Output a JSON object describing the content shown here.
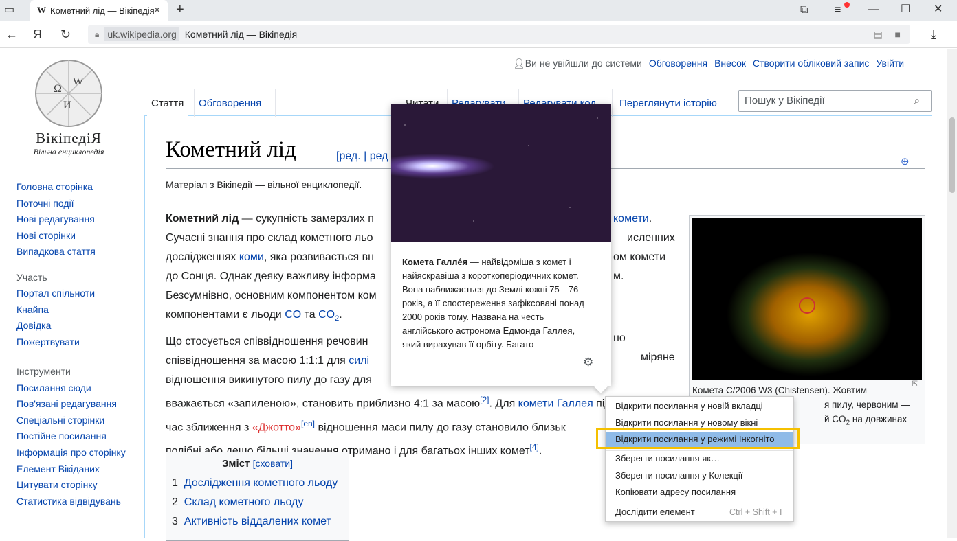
{
  "browser": {
    "tab_title": "Кометний лід — Вікіпедія",
    "favicon": "W",
    "url_domain": "uk.wikipedia.org",
    "url_title": "Кометний лід — Вікіпедія",
    "yandex_logo": "Я"
  },
  "top_links": {
    "not_logged": "Ви не увійшли до системи",
    "talk": "Обговорення",
    "contrib": "Внесок",
    "create": "Створити обліковий запис",
    "login": "Увійти"
  },
  "logo": {
    "name": "ВікіпедіЯ",
    "tagline": "Вільна енциклопедія"
  },
  "sidebar": {
    "nav": [
      "Головна сторінка",
      "Поточні події",
      "Нові редагування",
      "Нові сторінки",
      "Випадкова стаття"
    ],
    "participation_title": "Участь",
    "participation": [
      "Портал спільноти",
      "Кнайпа",
      "Довідка",
      "Пожертвувати"
    ],
    "tools_title": "Інструменти",
    "tools": [
      "Посилання сюди",
      "Пов'язані редагування",
      "Спеціальні сторінки",
      "Постійне посилання",
      "Інформація про сторінку",
      "Елемент Вікіданих",
      "Цитувати сторінку",
      "Статистика відвідувань"
    ]
  },
  "tabs": {
    "article": "Стаття",
    "discussion": "Обговорення",
    "read": "Читати",
    "edit": "Редагувати",
    "edit_code": "Редагувати код",
    "history": "Переглянути історію"
  },
  "search": {
    "placeholder": "Пошук у Вікіпедії"
  },
  "article": {
    "title": "Кометний лід",
    "edit_links": "[ред. | ред",
    "from": "Матеріал з Вікіпедії — вільної енциклопедії.",
    "p1_bold": "Кометний лід",
    "p1_a": " — сукупність замерзлих п",
    "p1_link_end": "комети",
    "l2_a": "Сучасні знання про склад кометного льо",
    "l2_b": "исленних",
    "l3_a": "дослідженнях ",
    "l3_link": "коми",
    "l3_b": ", яка розвивається вн",
    "l3_c": "ом комети",
    "l4_a": "до Сонця. Однак деяку важливу інформа",
    "l4_b": "м.",
    "l5_a": "Безсумнівно, основним компонентом ком",
    "l6_a": "компонентами є льоди ",
    "l6_co": "CO",
    "l6_and": " та ",
    "l6_co2": "CO",
    "l6_sub": "2",
    "l6_end": ".",
    "p2_l1_a": "Що стосується співвідношення речовин",
    "p2_l1_b": "но",
    "p2_l2_a": "співвідношення за масою 1:1:1 для ",
    "p2_l2_link": "силі",
    "p2_l2_b": "міряне",
    "p2_l3_a": "відношення викинутого пилу до газу для",
    "p2_l4_a": "вважається «запиленою», становить приблизно 4:1 за масою",
    "p2_l4_ref": "[2]",
    "p2_l4_b": ". Для ",
    "p2_l4_link": "комети Галлея",
    "p2_l4_c": " під",
    "p2_l5_a": "час зближення з ",
    "p2_l5_red": "«Джотто»",
    "p2_l5_ref": "[en]",
    "p2_l5_b": " відношення маси пилу до газу становило близьк",
    "p2_l6_a": "подібні або дещо більші значення отримано і для багатьох інших комет",
    "p2_l6_ref": "[4]",
    "p2_l6_b": "."
  },
  "toc": {
    "title": "Зміст",
    "hide": "[сховати]",
    "items": [
      {
        "n": "1",
        "t": "Дослідження кометного льоду"
      },
      {
        "n": "2",
        "t": "Склад кометного льоду"
      },
      {
        "n": "3",
        "t": "Активність віддалених комет"
      }
    ]
  },
  "figure": {
    "caption_l1": "Комета C/2006 W3 (Chistensen). Жовтим",
    "caption_l2": "я пилу, червоним —",
    "caption_l3": "й CO",
    "caption_sub": "2",
    "caption_l3b": " на довжинах"
  },
  "popup": {
    "bold": "Комета Галле́я",
    "text_lines": [
      " — найвідоміша з комет і",
      "найяскравіша з короткоперіодичних комет.",
      "Вона наближається до Землі кожні 75—76",
      "років, а її спостереження зафіксовані понад",
      "2000 років тому. Названа на честь",
      "англійського астронома Едмонда Галлея,",
      "який вирахував її орбіту. Багато"
    ]
  },
  "context_menu": {
    "items": [
      "Відкрити посилання у новій вкладці",
      "Відкрити посилання у новому вікні",
      "Відкрити посилання у режимі Інкогніто",
      "Зберегти посилання як…",
      "Зберегти посилання у Колекції",
      "Копіювати адресу посилання",
      "Дослідити елемент"
    ],
    "shortcut": "Ctrl + Shift + I",
    "highlight_color": "#f5c000"
  }
}
